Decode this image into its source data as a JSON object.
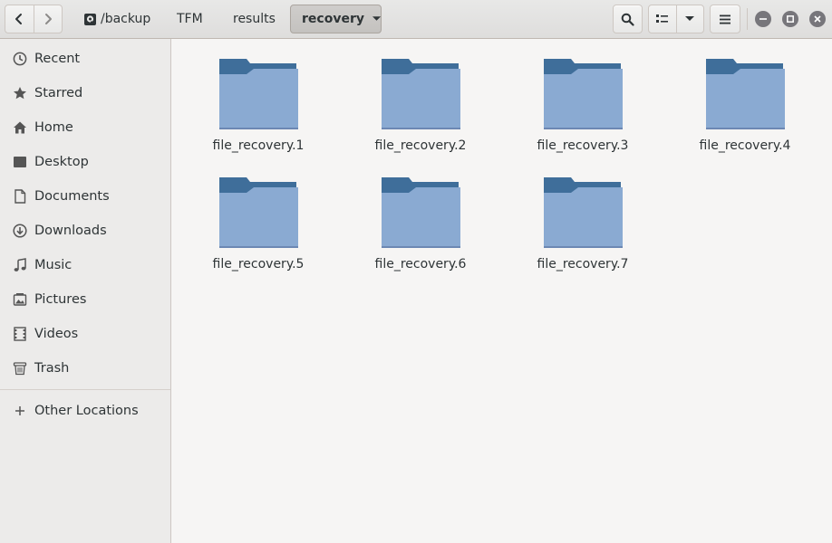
{
  "header": {
    "nav_back_icon": "chevron-left-icon",
    "nav_forward_icon": "chevron-right-icon",
    "breadcrumbs": [
      "/backup",
      "TFM",
      "results",
      "recovery"
    ],
    "search_icon": "search-icon",
    "view_icon": "list-view-icon",
    "menu_icon": "hamburger-icon"
  },
  "sidebar": {
    "items": [
      {
        "label": "Recent",
        "icon": "clock-icon"
      },
      {
        "label": "Starred",
        "icon": "star-icon"
      },
      {
        "label": "Home",
        "icon": "home-icon"
      },
      {
        "label": "Desktop",
        "icon": "desktop-icon"
      },
      {
        "label": "Documents",
        "icon": "document-icon"
      },
      {
        "label": "Downloads",
        "icon": "download-icon"
      },
      {
        "label": "Music",
        "icon": "music-icon"
      },
      {
        "label": "Pictures",
        "icon": "pictures-icon"
      },
      {
        "label": "Videos",
        "icon": "video-icon"
      },
      {
        "label": "Trash",
        "icon": "trash-icon"
      }
    ],
    "other_locations": {
      "label": "Other Locations",
      "icon": "plus-icon"
    }
  },
  "files": [
    {
      "name": "file_recovery.1"
    },
    {
      "name": "file_recovery.2"
    },
    {
      "name": "file_recovery.3"
    },
    {
      "name": "file_recovery.4"
    },
    {
      "name": "file_recovery.5"
    },
    {
      "name": "file_recovery.6"
    },
    {
      "name": "file_recovery.7"
    }
  ],
  "colors": {
    "folder_back": "#3f6e9a",
    "folder_front": "#8aaad2",
    "accent": "#77767b"
  }
}
